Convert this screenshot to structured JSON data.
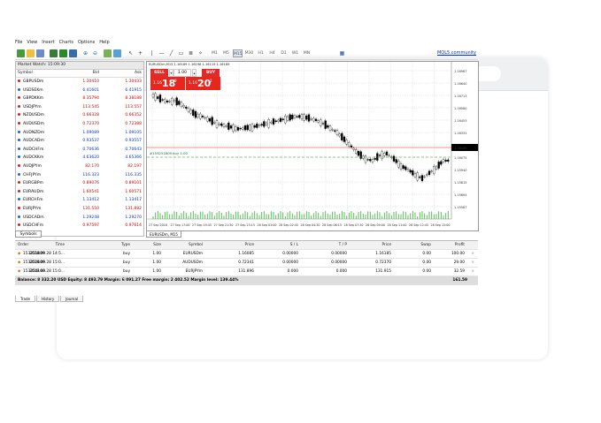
{
  "menu": [
    "File",
    "View",
    "Insert",
    "Charts",
    "Options",
    "Help"
  ],
  "toolbar": {
    "timeframes": [
      "M1",
      "M5",
      "M15",
      "M30",
      "H1",
      "H4",
      "D1",
      "W1",
      "MN"
    ],
    "active_timeframe": "M15",
    "community_link": "MQL5.community"
  },
  "market_watch": {
    "title": "Market Watch: 15:09:30",
    "headers": {
      "symbol": "Symbol",
      "bid": "Bid",
      "ask": "Ask"
    },
    "rows": [
      {
        "symbol": "GBPUSDm",
        "bid": "1.30410",
        "ask": "1.30433",
        "dir": "down"
      },
      {
        "symbol": "USDSEKm",
        "bid": "6.41601",
        "ask": "6.41915",
        "dir": "up"
      },
      {
        "symbol": "GBPDKKm",
        "bid": "8.35794",
        "ask": "8.38188",
        "dir": "down"
      },
      {
        "symbol": "USDJPYm",
        "bid": "113.545",
        "ask": "113.557",
        "dir": "down"
      },
      {
        "symbol": "NZDUSDm",
        "bid": "0.66328",
        "ask": "0.66352",
        "dir": "down"
      },
      {
        "symbol": "AUDUSDm",
        "bid": "0.72370",
        "ask": "0.72388",
        "dir": "down"
      },
      {
        "symbol": "AUDNZDm",
        "bid": "1.09089",
        "ask": "1.09105",
        "dir": "up"
      },
      {
        "symbol": "AUDCADm",
        "bid": "0.93537",
        "ask": "0.93557",
        "dir": "up"
      },
      {
        "symbol": "AUDCHFm",
        "bid": "0.70636",
        "ask": "0.70643",
        "dir": "up"
      },
      {
        "symbol": "AUDCKKm",
        "bid": "4.63620",
        "ask": "4.65366",
        "dir": "up"
      },
      {
        "symbol": "AUDJPYm",
        "bid": "82.170",
        "ask": "82.197",
        "dir": "down"
      },
      {
        "symbol": "CHFJPYm",
        "bid": "116.323",
        "ask": "116.335",
        "dir": "up"
      },
      {
        "symbol": "EURGBPm",
        "bid": "0.89076",
        "ask": "0.89101",
        "dir": "down"
      },
      {
        "symbol": "EURAUDm",
        "bid": "1.60541",
        "ask": "1.60571",
        "dir": "down"
      },
      {
        "symbol": "EURCHFm",
        "bid": "1.13412",
        "ask": "1.13417",
        "dir": "up"
      },
      {
        "symbol": "EURJPYm",
        "bid": "131.550",
        "ask": "131.882",
        "dir": "down"
      },
      {
        "symbol": "USDCADm",
        "bid": "1.29248",
        "ask": "1.29270",
        "dir": "up"
      },
      {
        "symbol": "USDCHFm",
        "bid": "0.97597",
        "ask": "0.97614",
        "dir": "down"
      }
    ],
    "tab_label": "Symbols"
  },
  "chart": {
    "info": "EURUSDm,M15  1.16189 1.16198 1.16119 1.16189",
    "sell_label": "SELL",
    "buy_label": "BUY",
    "lot": "1.00",
    "sell_price_prefix": "1.16",
    "sell_price_big": "18",
    "sell_price_sup": "9",
    "buy_price_prefix": "1.16",
    "buy_price_big": "20",
    "buy_price_sup": "2",
    "order_label": "#153251809 buy 1.00",
    "tab_label": "EURUSDm, M15",
    "y_ticks": [
      "1.16967",
      "1.16640",
      "1.16713",
      "1.16580",
      "1.16453",
      "1.16331",
      "1.16189",
      "1.16075",
      "1.15940",
      "1.15815",
      "1.15694",
      "1.15567"
    ],
    "x_ticks": [
      "27 Sep 2018",
      "27 Sep 17:00",
      "27 Sep 19:45",
      "27 Sep 21:30",
      "27 Sep 23:15",
      "28 Sep 01:00",
      "28 Sep 02:45",
      "28 Sep 04:30",
      "28 Sep 06:15",
      "28 Sep 07:30",
      "28 Sep 09:00",
      "28 Sep 11:00",
      "28 Sep 12:45",
      "28 Sep 15:00"
    ],
    "current_price": "1.16189",
    "colors": {
      "line": "#e8261e",
      "order_line": "#2a9d2a",
      "grid": "#c8c8c8"
    }
  },
  "terminal": {
    "headers": [
      "Order",
      "Time",
      "Type",
      "Size",
      "Symbol",
      "Price",
      "S / L",
      "T / P",
      "Price",
      "Swap",
      "Profit"
    ],
    "rows": [
      [
        "153251809",
        "2018.09.28 14:5...",
        "buy",
        "1.00",
        "EURUSDm",
        "1.16085",
        "0.00000",
        "0.00000",
        "1.16185",
        "0.00",
        "100.00"
      ],
      [
        "153252609",
        "2018.09.28 15:0...",
        "buy",
        "1.00",
        "AUDUSDm",
        "0.72341",
        "0.00000",
        "0.00000",
        "0.72370",
        "0.00",
        "29.00"
      ],
      [
        "153254160",
        "2018.09.28 15:0...",
        "buy",
        "1.00",
        "EURJPYm",
        "131.896",
        "0.000",
        "0.000",
        "131.915",
        "0.00",
        "32.59"
      ]
    ],
    "balance_line": "Balance: 8 332.20 USD  Equity: 8 493.79  Margin: 6 091.27  Free margin: 2 402.52  Margin level: 139.44%",
    "balance_total": "161.59",
    "tabs": [
      "Trade",
      "History",
      "Journal"
    ]
  }
}
